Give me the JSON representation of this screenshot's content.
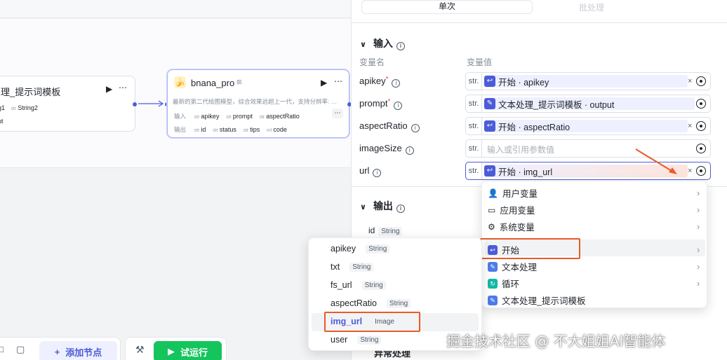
{
  "canvas": {
    "node1": {
      "title": "理_提示词模板",
      "inputs": [
        "g1",
        "String2"
      ],
      "output": "ut"
    },
    "node2": {
      "title": "bnana_pro",
      "desc": "最新的第二代绘图模型，综合效果远超上一代，支持分辨率: …",
      "input_label": "输入",
      "inputs": [
        {
          "type": "str",
          "name": "apikey"
        },
        {
          "type": "str",
          "name": "prompt"
        },
        {
          "type": "str",
          "name": "aspectRatio"
        }
      ],
      "output_label": "输出",
      "outputs": [
        {
          "type": "str",
          "name": "id"
        },
        {
          "type": "str",
          "name": "status"
        },
        {
          "type": "str",
          "name": "tips"
        },
        {
          "type": "int",
          "name": "code"
        }
      ]
    },
    "toolbar": {
      "add_node": "添加节点",
      "run": "试运行"
    }
  },
  "panel": {
    "tabs": {
      "single": "单次",
      "batch": "批处理"
    },
    "input_section": "输入",
    "col_name": "变量名",
    "col_value": "变量值",
    "rows": [
      {
        "name": "apikey",
        "required": true,
        "type": "str.",
        "value": "开始 · apikey"
      },
      {
        "name": "prompt",
        "required": true,
        "type": "str.",
        "value": "文本处理_提示词模板 · output"
      },
      {
        "name": "aspectRatio",
        "required": false,
        "type": "str.",
        "value": "开始 · aspectRatio"
      },
      {
        "name": "imageSize",
        "required": false,
        "type": "str.",
        "placeholder": "输入或引用参数值"
      },
      {
        "name": "url",
        "required": false,
        "type": "str.",
        "value": "开始 · img_url"
      }
    ],
    "output_section": "输出",
    "output_fields": [
      {
        "name": "id",
        "type": "String"
      }
    ],
    "partial_label": "异常处理"
  },
  "source_menu": [
    {
      "label": "用户变量",
      "icon": "user-icon"
    },
    {
      "label": "应用变量",
      "icon": "folder-icon"
    },
    {
      "label": "系统变量",
      "icon": "gear-icon"
    },
    {
      "label": "开始",
      "icon": "start-icon",
      "active": true
    },
    {
      "label": "文本处理",
      "icon": "text-process-icon"
    },
    {
      "label": "循环",
      "icon": "loop-icon"
    },
    {
      "label": "文本处理_提示词模板",
      "icon": "text-process-icon"
    }
  ],
  "var_menu": [
    {
      "name": "apikey",
      "type": "String"
    },
    {
      "name": "txt",
      "type": "String"
    },
    {
      "name": "fs_url",
      "type": "String"
    },
    {
      "name": "aspectRatio",
      "type": "String"
    },
    {
      "name": "img_url",
      "type": "Image",
      "selected": true
    },
    {
      "name": "user",
      "type": "String"
    }
  ],
  "watermark": "掘金技术社区 @ 不大姐姐AI智能体",
  "colors": {
    "accent": "#4c5cd8",
    "run": "#14c45c",
    "highlight": "#e85a2a",
    "required": "#f53f3f"
  }
}
